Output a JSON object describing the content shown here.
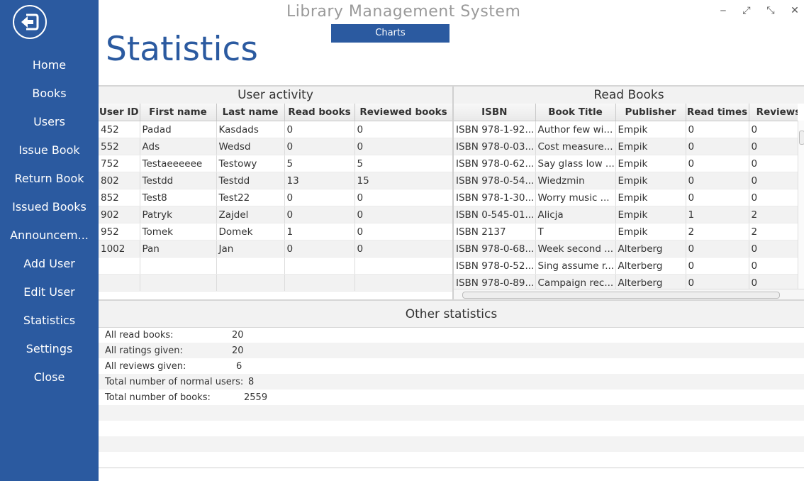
{
  "app_title": "Library Management System",
  "page_title": "Statistics",
  "charts_button": "Charts",
  "window_controls": {
    "minimize": "‒",
    "restore": "⤢",
    "maximize": "⤡",
    "close": "✕"
  },
  "sidebar": {
    "items": [
      {
        "label": "Home"
      },
      {
        "label": "Books"
      },
      {
        "label": "Users"
      },
      {
        "label": "Issue Book"
      },
      {
        "label": "Return Book"
      },
      {
        "label": "Issued Books"
      },
      {
        "label": "Announcem..."
      },
      {
        "label": "Add User"
      },
      {
        "label": "Edit User"
      },
      {
        "label": "Statistics"
      },
      {
        "label": "Settings"
      },
      {
        "label": "Close"
      }
    ]
  },
  "user_activity": {
    "title": "User activity",
    "columns": [
      "User ID",
      "First name",
      "Last name",
      "Read books",
      "Reviewed books"
    ],
    "rows": [
      [
        "452",
        "Padad",
        "Kasdads",
        "0",
        "0"
      ],
      [
        "552",
        "Ads",
        "Wedsd",
        "0",
        "0"
      ],
      [
        "752",
        "Testaeeeeee",
        "Testowy",
        "5",
        "5"
      ],
      [
        "802",
        "Testdd",
        "Testdd",
        "13",
        "15"
      ],
      [
        "852",
        "Test8",
        "Test22",
        "0",
        "0"
      ],
      [
        "902",
        "Patryk",
        "Zajdel",
        "0",
        "0"
      ],
      [
        "952",
        "Tomek",
        "Domek",
        "1",
        "0"
      ],
      [
        "1002",
        "Pan",
        "Jan",
        "0",
        "0"
      ]
    ]
  },
  "read_books": {
    "title": "Read Books",
    "columns": [
      "ISBN",
      "Book Title",
      "Publisher",
      "Read times",
      "Reviews"
    ],
    "rows": [
      [
        "ISBN 978-1-92...",
        "Author few wi...",
        "Empik",
        "0",
        "0"
      ],
      [
        "ISBN 978-0-03...",
        "Cost measure...",
        "Empik",
        "0",
        "0"
      ],
      [
        "ISBN 978-0-62...",
        "Say glass low ...",
        "Empik",
        "0",
        "0"
      ],
      [
        "ISBN 978-0-54...",
        "Wiedzmin",
        "Empik",
        "0",
        "0"
      ],
      [
        "ISBN 978-1-30...",
        "Worry music ...",
        "Empik",
        "0",
        "0"
      ],
      [
        "ISBN 0-545-01...",
        "Alicja",
        "Empik",
        "1",
        "2"
      ],
      [
        "ISBN 2137",
        "T",
        "Empik",
        "2",
        "2"
      ],
      [
        "ISBN 978-0-68...",
        "Week second ...",
        "Alterberg",
        "0",
        "0"
      ],
      [
        "ISBN 978-0-52...",
        "Sing assume r...",
        "Alterberg",
        "0",
        "0"
      ],
      [
        "ISBN 978-0-89...",
        "Campaign rec...",
        "Alterberg",
        "0",
        "0"
      ]
    ]
  },
  "other_statistics": {
    "title": "Other statistics",
    "items": [
      {
        "label": "All read books:",
        "value": "20"
      },
      {
        "label": "All ratings given:",
        "value": "20"
      },
      {
        "label": "All reviews given:",
        "value": "6"
      },
      {
        "label": "Total number of normal users:",
        "value": "8"
      },
      {
        "label": "Total number of books:",
        "value": "2559"
      }
    ]
  },
  "colors": {
    "accent": "#2b5aa0",
    "title_gray": "#9a9a9a"
  }
}
